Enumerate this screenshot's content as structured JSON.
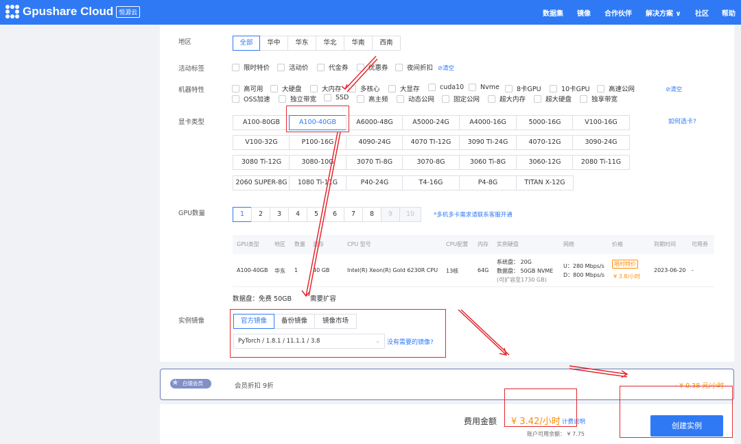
{
  "header": {
    "brand": "Gpushare Cloud",
    "brand_badge": "恒源云",
    "nav": [
      "数据集",
      "镜像",
      "合作伙伴",
      "解决方案 ∨",
      "社区",
      "帮助"
    ]
  },
  "region": {
    "label": "地区",
    "options": [
      "全部",
      "华中",
      "华东",
      "华北",
      "华南",
      "西南"
    ]
  },
  "activity": {
    "label": "活动标签",
    "options": [
      "限时特价",
      "活动价",
      "代金券",
      "优惠券",
      "夜间折扣"
    ],
    "clear": "清空"
  },
  "features": {
    "label": "机器特性",
    "row1": [
      "高可用",
      "大硬盘",
      "大内存",
      "多核心",
      "大显存",
      "cuda10",
      "Nvme",
      "8卡GPU",
      "10卡GPU",
      "高速公网"
    ],
    "row2": [
      "OSS加速",
      "独立带宽",
      "SSD",
      "高主频",
      "动态公网",
      "固定公网",
      "超大内存",
      "超大硬盘",
      "独享带宽"
    ],
    "clear": "清空"
  },
  "gpu_type": {
    "label": "显卡类型",
    "help": "如何选卡?",
    "rows": [
      [
        "A100-80GB",
        "A100-40GB",
        "A6000-48G",
        "A5000-24G",
        "A4000-16G",
        "5000-16G",
        "V100-16G"
      ],
      [
        "V100-32G",
        "P100-16G",
        "4090-24G",
        "4070 TI-12G",
        "3090 TI-24G",
        "4070-12G",
        "3090-24G"
      ],
      [
        "3080 Ti-12G",
        "3080-10G",
        "3070 Ti-8G",
        "3070-8G",
        "3060 Ti-8G",
        "3060-12G",
        "2080 Ti-11G"
      ],
      [
        "2060 SUPER-8G",
        "1080 Ti-11G",
        "P40-24G",
        "T4-16G",
        "P4-8G",
        "TITAN X-12G"
      ]
    ]
  },
  "gpu_count": {
    "label": "GPU数量",
    "options": [
      "1",
      "2",
      "3",
      "4",
      "5",
      "6",
      "7",
      "8",
      "9",
      "10"
    ],
    "note": "*多机多卡需求请联系客服开通"
  },
  "table": {
    "headers": [
      "GPU类型",
      "地区",
      "数量",
      "显存",
      "CPU 型号",
      "CPU配置",
      "内存",
      "实例硬盘",
      "网络",
      "价格",
      "到期时间",
      "可用券"
    ],
    "row": {
      "gpu": "A100-40GB",
      "region": "华东",
      "count": "1",
      "vram": "40 GB",
      "cpu": "Intel(R) Xeon(R) Gold 6230R CPU",
      "cores": "13核",
      "mem": "64G",
      "disk1": "系统盘：  20G",
      "disk2": "数据盘：  50GB NVME",
      "disk3": "(可扩容至1730 GB)",
      "net_up": "U：280 Mbps/s",
      "net_down": "D：800 Mbps/s",
      "tag": "限时特价",
      "price": "¥ 3.8/小时",
      "expire": "2023-06-20",
      "coupon": "-"
    }
  },
  "datadisk": {
    "text": "数据盘：免费 50GB",
    "expand": "需要扩容"
  },
  "image": {
    "label": "实例镜像",
    "tabs": [
      "官方镜像",
      "备份镜像",
      "镜像市场"
    ],
    "select": "PyTorch / 1.8.1 / 11.1.1 / 3.8",
    "missing": "没有需要的镜像?"
  },
  "member": {
    "badge": "白银会员",
    "text": "会员折扣 9折",
    "discount": "- ¥ 0.38 元/小时"
  },
  "footer": {
    "fee_label": "费用金额",
    "fee": "¥ 3.42/小时",
    "fee_link": "计费说明",
    "balance": "账户可用余额：  ¥ 7.75",
    "create": "创建实例"
  },
  "colors": {
    "primary": "#2f7af4",
    "annotation": "#e3262b",
    "price": "#ff8a00"
  }
}
